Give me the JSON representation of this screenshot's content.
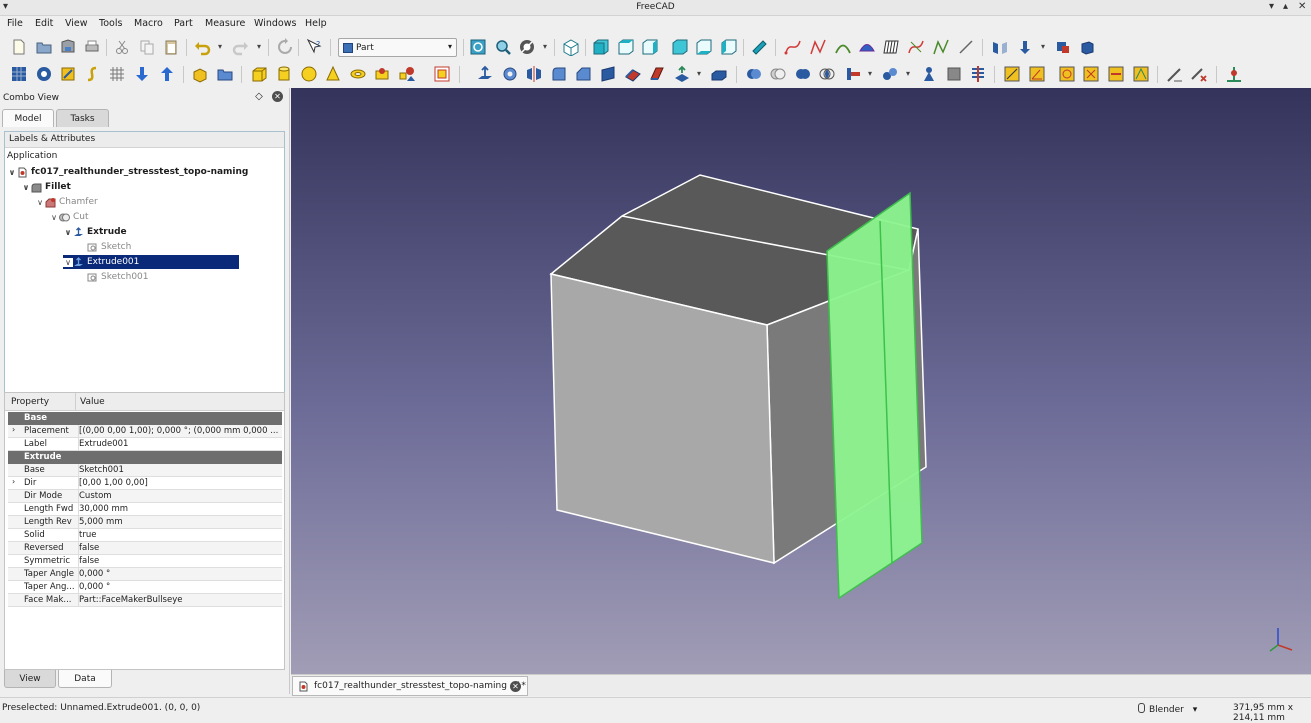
{
  "window": {
    "title": "FreeCAD"
  },
  "menu": [
    "File",
    "Edit",
    "View",
    "Tools",
    "Macro",
    "Part",
    "Measure",
    "Windows",
    "Help"
  ],
  "workbench": {
    "selected": "Part"
  },
  "combo_view": {
    "title": "Combo View",
    "tabs": [
      "Model",
      "Tasks"
    ],
    "active_tab": "Model",
    "bottom_tabs": [
      "View",
      "Data"
    ],
    "active_bottom_tab": "Data"
  },
  "tree": {
    "header": "Labels & Attributes",
    "root": "Application",
    "items": [
      {
        "label": "fc017_realthunder_stresstest_topo-naming",
        "icon": "document-icon"
      },
      {
        "label": "Fillet",
        "icon": "fillet-icon"
      },
      {
        "label": "Chamfer",
        "icon": "chamfer-icon"
      },
      {
        "label": "Cut",
        "icon": "cut-icon"
      },
      {
        "label": "Extrude",
        "icon": "extrude-icon"
      },
      {
        "label": "Sketch",
        "icon": "sketch-icon"
      },
      {
        "label": "Extrude001",
        "icon": "extrude-icon",
        "selected": true
      },
      {
        "label": "Sketch001",
        "icon": "sketch-icon"
      }
    ]
  },
  "properties": {
    "col_property": "Property",
    "col_value": "Value",
    "rows": [
      {
        "group": "Base"
      },
      {
        "name": "Placement",
        "value": "[(0,00 0,00 1,00); 0,000 °; (0,000 mm  0,000 ...",
        "expandable": true
      },
      {
        "name": "Label",
        "value": "Extrude001"
      },
      {
        "group": "Extrude"
      },
      {
        "name": "Base",
        "value": "Sketch001"
      },
      {
        "name": "Dir",
        "value": "[0,00 1,00 0,00]",
        "expandable": true
      },
      {
        "name": "Dir Mode",
        "value": "Custom"
      },
      {
        "name": "Length Fwd",
        "value": "30,000 mm"
      },
      {
        "name": "Length Rev",
        "value": "5,000 mm"
      },
      {
        "name": "Solid",
        "value": "true"
      },
      {
        "name": "Reversed",
        "value": "false"
      },
      {
        "name": "Symmetric",
        "value": "false"
      },
      {
        "name": "Taper Angle",
        "value": "0,000 °"
      },
      {
        "name": "Taper Ang...",
        "value": "0,000 °"
      },
      {
        "name": "Face Mak...",
        "value": "Part::FaceMakerBullseye"
      }
    ]
  },
  "document_tab": {
    "label": "fc017_realthunder_stresstest_topo-naming : 1*"
  },
  "status": {
    "message": "Preselected: Unnamed.Extrude001. (0, 0, 0)",
    "nav_style": "Blender",
    "dimensions": "371,95 mm x 214,11 mm"
  },
  "colors": {
    "selection": "#0a2a79",
    "highlight_face": "#8df58f",
    "bg_top": "#33335b",
    "bg_bottom": "#a19db6"
  }
}
